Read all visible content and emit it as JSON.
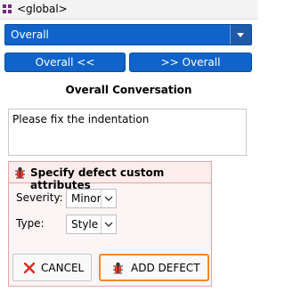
{
  "title_bar": {
    "title": "<global>",
    "icon": "grid-icon"
  },
  "filter": {
    "selected": "Overall"
  },
  "navigation": {
    "prev_label": "Overall <<",
    "next_label": ">> Overall"
  },
  "conversation": {
    "heading": "Overall Conversation",
    "comment_text": "Please fix the indentation"
  },
  "defect_form": {
    "title": "Specify defect custom attributes",
    "fields": [
      {
        "label": "Severity:",
        "value": "Minor"
      },
      {
        "label": "Type:",
        "value": "Style"
      }
    ],
    "cancel_label": "CANCEL",
    "add_label": "ADD DEFECT"
  },
  "colors": {
    "primary": "#0f63c9",
    "panel_border": "#e3a5a5",
    "focus_border": "#ee8a2e",
    "cancel_red": "#d93025"
  }
}
